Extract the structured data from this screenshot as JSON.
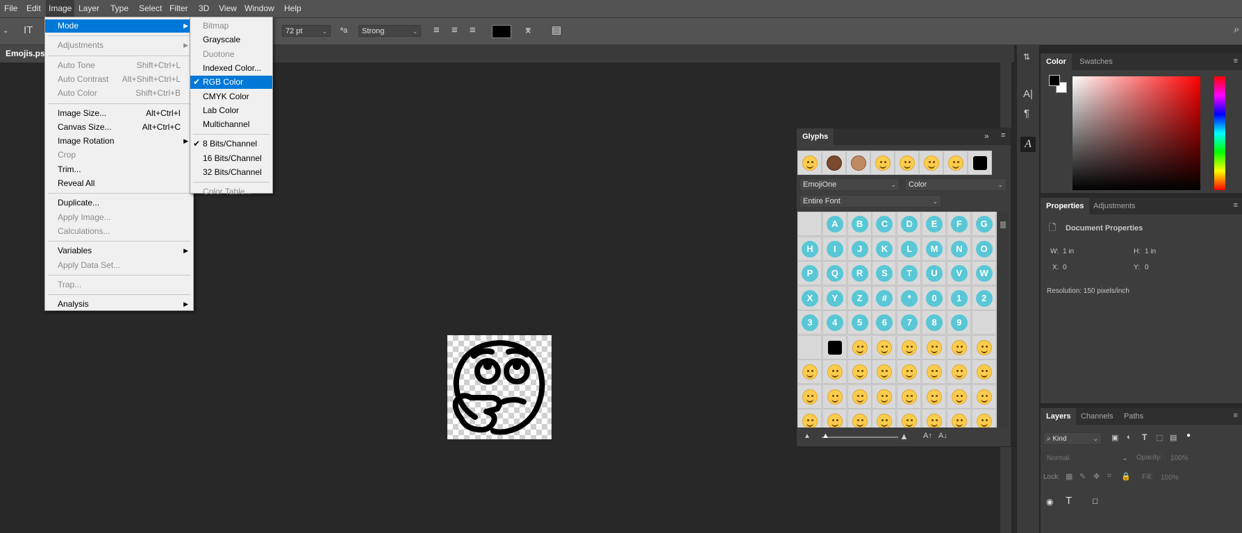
{
  "menubar": {
    "items": [
      "File",
      "Edit",
      "Image",
      "Layer",
      "Type",
      "Select",
      "Filter",
      "3D",
      "View",
      "Window",
      "Help"
    ],
    "active": "Image"
  },
  "options": {
    "size_value": "72 pt",
    "antialias_value": "Strong",
    "text_color": "#000000"
  },
  "document": {
    "tab_label": "Emojis.psd"
  },
  "image_menu": {
    "items": [
      {
        "label": "Mode",
        "shortcut": "",
        "submenu": true,
        "disabled": false,
        "highlighted": true
      },
      {
        "sep": true
      },
      {
        "label": "Adjustments",
        "shortcut": "",
        "submenu": true,
        "disabled": true
      },
      {
        "sep": true
      },
      {
        "label": "Auto Tone",
        "shortcut": "Shift+Ctrl+L",
        "disabled": true
      },
      {
        "label": "Auto Contrast",
        "shortcut": "Alt+Shift+Ctrl+L",
        "disabled": true
      },
      {
        "label": "Auto Color",
        "shortcut": "Shift+Ctrl+B",
        "disabled": true
      },
      {
        "sep": true
      },
      {
        "label": "Image Size...",
        "shortcut": "Alt+Ctrl+I",
        "disabled": false
      },
      {
        "label": "Canvas Size...",
        "shortcut": "Alt+Ctrl+C",
        "disabled": false
      },
      {
        "label": "Image Rotation",
        "shortcut": "",
        "submenu": true,
        "disabled": false
      },
      {
        "label": "Crop",
        "shortcut": "",
        "disabled": true
      },
      {
        "label": "Trim...",
        "shortcut": "",
        "disabled": false
      },
      {
        "label": "Reveal All",
        "shortcut": "",
        "disabled": false
      },
      {
        "sep": true
      },
      {
        "label": "Duplicate...",
        "shortcut": "",
        "disabled": false
      },
      {
        "label": "Apply Image...",
        "shortcut": "",
        "disabled": true
      },
      {
        "label": "Calculations...",
        "shortcut": "",
        "disabled": true
      },
      {
        "sep": true
      },
      {
        "label": "Variables",
        "shortcut": "",
        "submenu": true,
        "disabled": false
      },
      {
        "label": "Apply Data Set...",
        "shortcut": "",
        "disabled": true
      },
      {
        "sep": true
      },
      {
        "label": "Trap...",
        "shortcut": "",
        "disabled": true
      },
      {
        "sep": true
      },
      {
        "label": "Analysis",
        "shortcut": "",
        "submenu": true,
        "disabled": false
      }
    ]
  },
  "mode_menu": {
    "items": [
      {
        "label": "Bitmap",
        "disabled": true
      },
      {
        "label": "Grayscale",
        "disabled": false
      },
      {
        "label": "Duotone",
        "disabled": true
      },
      {
        "label": "Indexed Color...",
        "disabled": false
      },
      {
        "label": "RGB Color",
        "disabled": false,
        "checked": true,
        "highlighted": true
      },
      {
        "label": "CMYK Color",
        "disabled": false
      },
      {
        "label": "Lab Color",
        "disabled": false
      },
      {
        "label": "Multichannel",
        "disabled": false
      },
      {
        "sep": true
      },
      {
        "label": "8 Bits/Channel",
        "disabled": false,
        "checked": true
      },
      {
        "label": "16 Bits/Channel",
        "disabled": false
      },
      {
        "label": "32 Bits/Channel",
        "disabled": false
      },
      {
        "sep": true
      },
      {
        "label": "Color Table...",
        "disabled": true
      }
    ]
  },
  "glyphs": {
    "title": "Glyphs",
    "font_value": "EmojiOne",
    "style_value": "Color",
    "filter_value": "Entire Font",
    "letters": [
      "A",
      "B",
      "C",
      "D",
      "E",
      "F",
      "G",
      "H",
      "I",
      "J",
      "K",
      "L",
      "M",
      "N",
      "O",
      "P",
      "Q",
      "R",
      "S",
      "T",
      "U",
      "V",
      "W",
      "X",
      "Y",
      "Z",
      "#",
      "*",
      "0",
      "1",
      "2",
      "3",
      "4",
      "5",
      "6",
      "7",
      "8",
      "9"
    ]
  },
  "color_panel": {
    "tabs": [
      "Color",
      "Swatches"
    ],
    "foreground": "#000000",
    "background": "#ffffff"
  },
  "properties_panel": {
    "tabs": [
      "Properties",
      "Adjustments"
    ],
    "heading": "Document Properties",
    "w_label": "W:",
    "w_value": "1 in",
    "h_label": "H:",
    "h_value": "1 in",
    "x_label": "X:",
    "x_value": "0",
    "y_label": "Y:",
    "y_value": "0",
    "resolution": "Resolution: 150 pixels/inch"
  },
  "layers_panel": {
    "tabs": [
      "Layers",
      "Channels",
      "Paths"
    ],
    "kind_value": "Kind",
    "blend_value": "Normal",
    "opacity_label": "Opacity:",
    "opacity_value": "100%",
    "lock_label": "Lock:",
    "fill_label": "Fill:",
    "fill_value": "100%"
  }
}
